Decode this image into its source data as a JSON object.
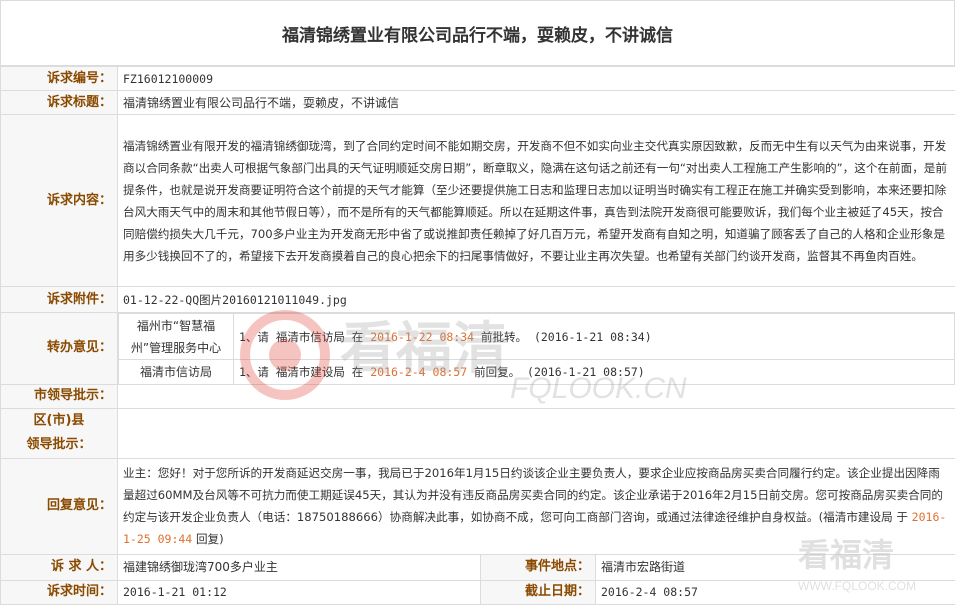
{
  "page_title": "福清锦绣置业有限公司品行不端，耍赖皮，不讲诚信",
  "fields": {
    "case_no": {
      "label": "诉求编号：",
      "value": "FZ16012100009"
    },
    "subject": {
      "label": "诉求标题：",
      "value": "福清锦绣置业有限公司品行不端，耍赖皮，不讲诚信"
    },
    "content": {
      "label": "诉求内容：",
      "value": "福清锦绣置业有限开发的福清锦绣御珑湾，到了合同约定时间不能如期交房，开发商不但不如实向业主交代真实原因致歉，反而无中生有以天气为由来说事，开发商以合同条款“出卖人可根据气象部门出具的天气证明顺延交房日期”，断章取义，隐满在这句话之前还有一句“对出卖人工程施工产生影响的”，这个在前面，是前提条件，也就是说开发商要证明符合这个前提的天气才能算（至少还要提供施工日志和监理日志加以证明当时确实有工程正在施工并确实受到影响，本来还要扣除台风大雨天气中的周末和其他节假日等），而不是所有的天气都能算顺延。所以在延期这件事，真告到法院开发商很可能要败诉，我们每个业主被延了45天，按合同赔偿约损失大几千元，700多户业主为开发商无形中省了或说推卸责任赖掉了好几百万元，希望开发商有自知之明，知道骗了顾客丢了自己的人格和企业形象是用多少钱换回不了的，希望接下去开发商摸着自己的良心把余下的扫尾事情做好，不要让业主再次失望。也希望有关部门约谈开发商，监督其不再鱼肉百姓。"
    },
    "attachment": {
      "label": "诉求附件：",
      "value": "01-12-22-QQ图片20160121011049.jpg"
    },
    "transfer": {
      "label": "转办意见：",
      "rows": [
        {
          "org": "福州市“智慧福州”管理服务中心",
          "prefix": "1、请 福清市信访局 在",
          "deadline": "2016-1-22 08:34",
          "suffix": "前批转。 (2016-1-21 08:34)"
        },
        {
          "org": "福清市信访局",
          "prefix": "1、请 福清市建设局 在",
          "deadline": "2016-2-4 08:57",
          "suffix": "前回复。 (2016-1-21 08:57)"
        }
      ]
    },
    "city_leader": {
      "label": "市领导批示：",
      "value": ""
    },
    "district_leader": {
      "label_1": "区(市)县",
      "label_2": "领导批示：",
      "value": ""
    },
    "reply": {
      "label": "回复意见：",
      "text": "业主：您好！对于您所诉的开发商延迟交房一事，我局已于2016年1月15日约谈该企业主要负责人，要求企业应按商品房买卖合同履行约定。该企业提出因降雨量超过60MM及台风等不可抗力而使工期延误45天，其认为并没有违反商品房买卖合同的约定。该企业承诺于2016年2月15日前交房。您可按商品房买卖合同的约定与该开发企业负责人（电话：18750188666）协商解决此事，如协商不成，您可向工商部门咨询，或通过法律途径维护自身权益。(福清市建设局 于",
      "date": "2016-1-25 09:44",
      "tail": "回复)"
    },
    "petitioner": {
      "label": "诉 求 人：",
      "value": "福建锦绣御珑湾700多户业主"
    },
    "location": {
      "label": "事件地点：",
      "value": "福清市宏路街道"
    },
    "time": {
      "label": "诉求时间：",
      "value": "2016-1-21 01:12"
    },
    "deadline": {
      "label": "截止日期：",
      "value": "2016-2-4 08:57"
    }
  },
  "watermark": {
    "text_cn": "看福清",
    "text_en": "FQLOOK.CN",
    "corner_cn": "看福清",
    "corner_en": "WWW.FQLOOK.COM"
  },
  "colors": {
    "label": "#8a4a00",
    "date": "#e07030",
    "border": "#dcdcdc"
  }
}
